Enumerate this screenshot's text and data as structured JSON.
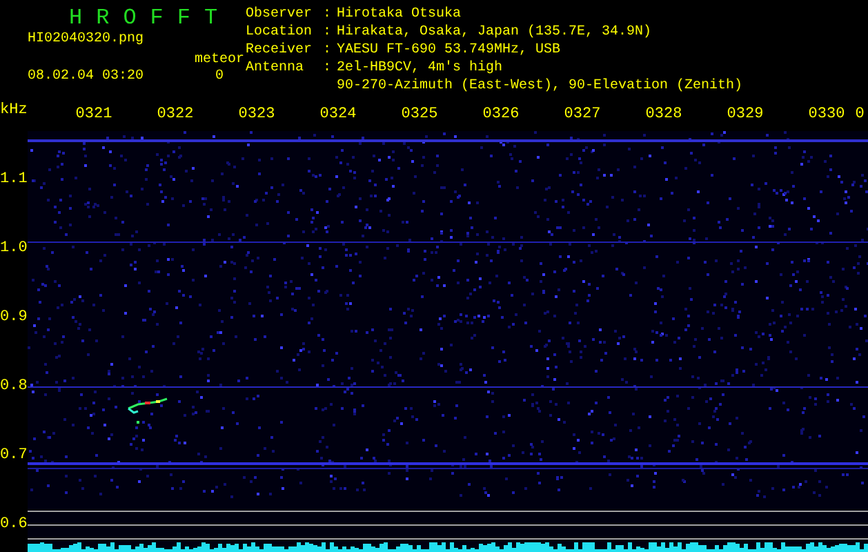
{
  "header": {
    "title": "HROFFT",
    "filename": "HI02040320.png",
    "datetime": "08.02.04 03:20",
    "counter": {
      "label": "meteor",
      "value": "0"
    }
  },
  "separator": ":",
  "station": [
    {
      "label": "Observer",
      "lines": [
        "Hirotaka Otsuka"
      ]
    },
    {
      "label": "Location",
      "lines": [
        "Hirakata, Osaka, Japan (135.7E, 34.9N)"
      ]
    },
    {
      "label": "Receiver",
      "lines": [
        "YAESU FT-690 53.749MHz, USB"
      ]
    },
    {
      "label": "Antenna",
      "lines": [
        "2el-HB9CV, 4m's high",
        "90-270-Azimuth (East-West), 90-Elevation (Zenith)"
      ]
    }
  ],
  "spectrogram": {
    "unit": "kHz",
    "time_labels": [
      "0321",
      "0322",
      "0323",
      "0324",
      "0325",
      "0326",
      "0327",
      "0328",
      "0329",
      "0330",
      "0"
    ],
    "freq_labels": [
      "1.1",
      "1.0",
      "0.9",
      "0.8",
      "0.7",
      "0.6"
    ]
  }
}
